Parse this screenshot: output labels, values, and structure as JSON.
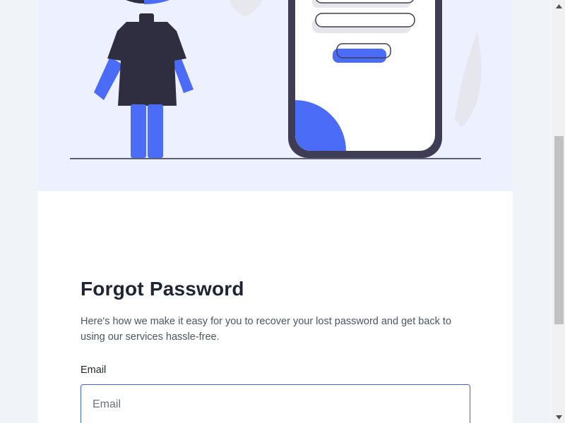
{
  "page": {
    "title": "Forgot Password",
    "description": "Here's how we make it easy for you to recover your lost password and get back to using our services hassle-free."
  },
  "form": {
    "email_label": "Email",
    "email_placeholder": "Email",
    "email_value": ""
  },
  "colors": {
    "accent": "#4a6cf7",
    "dark": "#2f2e41",
    "illustration_bg": "#edf0fe",
    "input_border": "#3f63c9"
  },
  "icons": {
    "scroll_up": "triangle-up",
    "scroll_down": "triangle-down"
  }
}
